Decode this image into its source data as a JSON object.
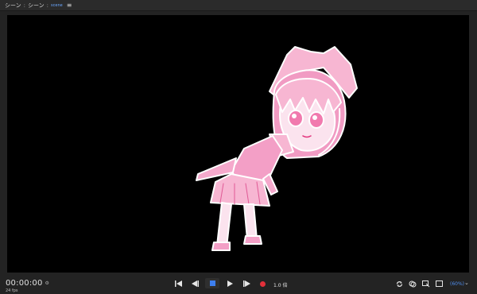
{
  "titlebar": {
    "part1": "シーン",
    "separator": ":",
    "part2": "シーン",
    "part3_active": "scene",
    "menu_icon": "hamburger-icon"
  },
  "viewer": {
    "content": "pink-line-art-chibi-character-on-black"
  },
  "transport": {
    "timecode": "00:00:00",
    "fps": "24 fps",
    "speed": "1.0 倍",
    "icons": [
      "skip-to-start-icon",
      "step-back-icon",
      "stop-icon",
      "play-icon",
      "step-forward-icon",
      "record-icon"
    ],
    "stop_color": "#3d7ff0",
    "record_color": "#e2303a"
  },
  "right_tools": {
    "icons": [
      "loop-icon",
      "onion-skin-icon",
      "overlay-icon",
      "frame-icon"
    ],
    "zoom": "(60%)"
  }
}
